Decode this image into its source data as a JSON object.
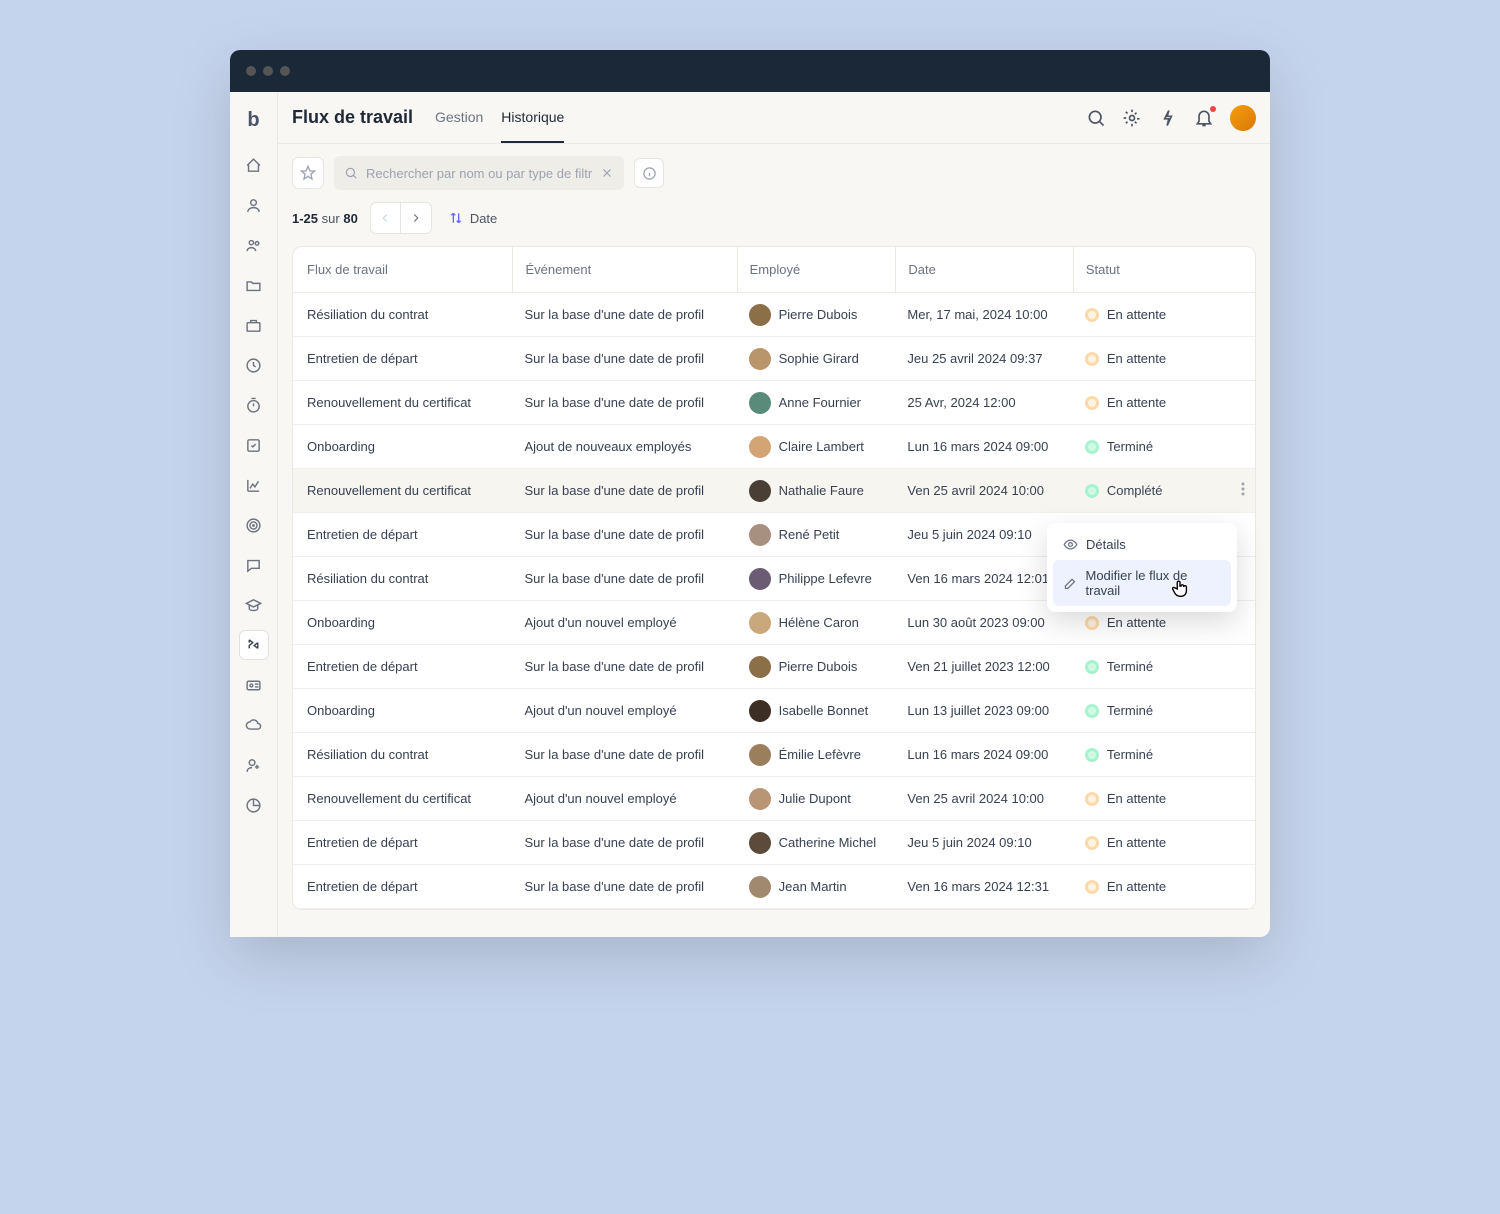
{
  "page": {
    "title": "Flux de travail",
    "tabs": [
      "Gestion",
      "Historique"
    ],
    "activeTab": 1
  },
  "search": {
    "placeholder": "Rechercher par nom ou par type de filtre..."
  },
  "pagination": {
    "from": "1-25",
    "sep": "sur",
    "total": "80"
  },
  "sort": {
    "label": "Date"
  },
  "columns": [
    "Flux de travail",
    "Événement",
    "Employé",
    "Date",
    "Statut"
  ],
  "statusLabels": {
    "pending": "En attente",
    "done": "Terminé",
    "complete": "Complété"
  },
  "menu": {
    "details": "Détails",
    "edit": "Modifier le flux de travail"
  },
  "rows": [
    {
      "flux": "Résiliation du contrat",
      "event": "Sur la base d'une date de profil",
      "emp": "Pierre Dubois",
      "date": "Mer, 17 mai, 2024 10:00",
      "status": "pending",
      "avatar": "#8b6f47"
    },
    {
      "flux": "Entretien de départ",
      "event": "Sur la base d'une date de profil",
      "emp": "Sophie Girard",
      "date": "Jeu 25 avril 2024 09:37",
      "status": "pending",
      "avatar": "#b8956a"
    },
    {
      "flux": "Renouvellement du certificat",
      "event": "Sur la base d'une date de profil",
      "emp": "Anne Fournier",
      "date": "25 Avr, 2024 12:00",
      "status": "pending",
      "avatar": "#5a8a7a"
    },
    {
      "flux": "Onboarding",
      "event": "Ajout de nouveaux employés",
      "emp": "Claire Lambert",
      "date": "Lun 16 mars 2024 09:00",
      "status": "done",
      "avatar": "#d4a574"
    },
    {
      "flux": "Renouvellement du certificat",
      "event": "Sur la base d'une date de profil",
      "emp": "Nathalie Faure",
      "date": "Ven 25 avril 2024 10:00",
      "status": "complete",
      "avatar": "#4a3f35",
      "highlighted": true,
      "menu": true
    },
    {
      "flux": "Entretien de départ",
      "event": "Sur la base d'une date de profil",
      "emp": "René Petit",
      "date": "Jeu 5 juin 2024 09:10",
      "status": "pending",
      "avatar": "#a89080"
    },
    {
      "flux": "Résiliation du contrat",
      "event": "Sur la base d'une date de profil",
      "emp": "Philippe Lefevre",
      "date": "Ven 16 mars 2024 12:01",
      "status": "pending",
      "avatar": "#6b5b73"
    },
    {
      "flux": "Onboarding",
      "event": "Ajout d'un nouvel employé",
      "emp": "Hélène Caron",
      "date": "Lun 30 août 2023 09:00",
      "status": "pending",
      "avatar": "#c9a87c"
    },
    {
      "flux": "Entretien de départ",
      "event": "Sur la base d'une date de profil",
      "emp": "Pierre Dubois",
      "date": "Ven 21 juillet 2023 12:00",
      "status": "done",
      "avatar": "#8b6f47"
    },
    {
      "flux": "Onboarding",
      "event": "Ajout d'un nouvel employé",
      "emp": "Isabelle Bonnet",
      "date": "Lun 13 juillet 2023 09:00",
      "status": "done",
      "avatar": "#3d2e25"
    },
    {
      "flux": "Résiliation du contrat",
      "event": "Sur la base d'une date de profil",
      "emp": "Émilie Lefèvre",
      "date": "Lun 16 mars 2024 09:00",
      "status": "done",
      "avatar": "#9b7e5c"
    },
    {
      "flux": "Renouvellement du certificat",
      "event": "Ajout d'un nouvel employé",
      "emp": "Julie Dupont",
      "date": "Ven 25 avril 2024 10:00",
      "status": "pending",
      "avatar": "#b89574"
    },
    {
      "flux": "Entretien de départ",
      "event": "Sur la base d'une date de profil",
      "emp": "Catherine Michel",
      "date": "Jeu 5 juin 2024 09:10",
      "status": "pending",
      "avatar": "#5c4a3a"
    },
    {
      "flux": "Entretien de départ",
      "event": "Sur la base d'une date de profil",
      "emp": "Jean Martin",
      "date": "Ven 16 mars 2024 12:31",
      "status": "pending",
      "avatar": "#a0896f"
    }
  ]
}
